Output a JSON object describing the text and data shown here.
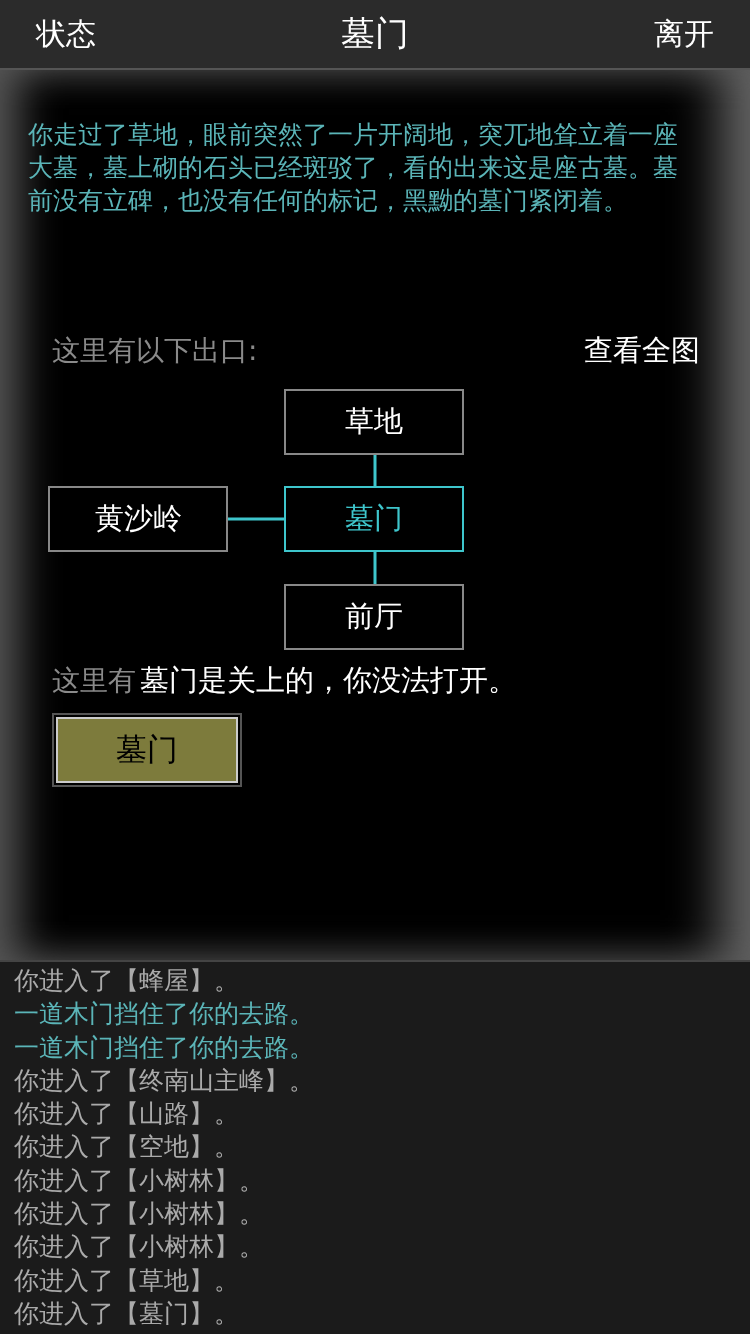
{
  "header": {
    "left": "状态",
    "title": "墓门",
    "right": "离开"
  },
  "description": "你走过了草地，眼前突然了一片开阔地，突兀地耸立着一座大墓，墓上砌的石头已经斑驳了，看的出来这是座古墓。墓前没有立碑，也没有任何的标记，黑黝的墓门紧闭着。",
  "exits_label": "这里有以下出口:",
  "map_link": "查看全图",
  "map_nodes": [
    {
      "label": "草地",
      "kind": "north",
      "current": false
    },
    {
      "label": "黄沙岭",
      "kind": "west",
      "current": false
    },
    {
      "label": "墓门",
      "kind": "center",
      "current": true
    },
    {
      "label": "前厅",
      "kind": "south",
      "current": false
    }
  ],
  "objects_label": "这里有",
  "toast": "墓门是关上的，你没法打开。",
  "object_buttons": [
    "墓门"
  ],
  "log": [
    {
      "text": "你进入了【蜂屋】。",
      "kind": "normal"
    },
    {
      "text": "一道木门挡住了你的去路。",
      "kind": "notice"
    },
    {
      "text": "一道木门挡住了你的去路。",
      "kind": "notice"
    },
    {
      "text": "你进入了【终南山主峰】。",
      "kind": "normal"
    },
    {
      "text": "你进入了【山路】。",
      "kind": "normal"
    },
    {
      "text": "你进入了【空地】。",
      "kind": "normal"
    },
    {
      "text": "你进入了【小树林】。",
      "kind": "normal"
    },
    {
      "text": "你进入了【小树林】。",
      "kind": "normal"
    },
    {
      "text": "你进入了【小树林】。",
      "kind": "normal"
    },
    {
      "text": "你进入了【草地】。",
      "kind": "normal"
    },
    {
      "text": "你进入了【墓门】。",
      "kind": "normal"
    }
  ]
}
